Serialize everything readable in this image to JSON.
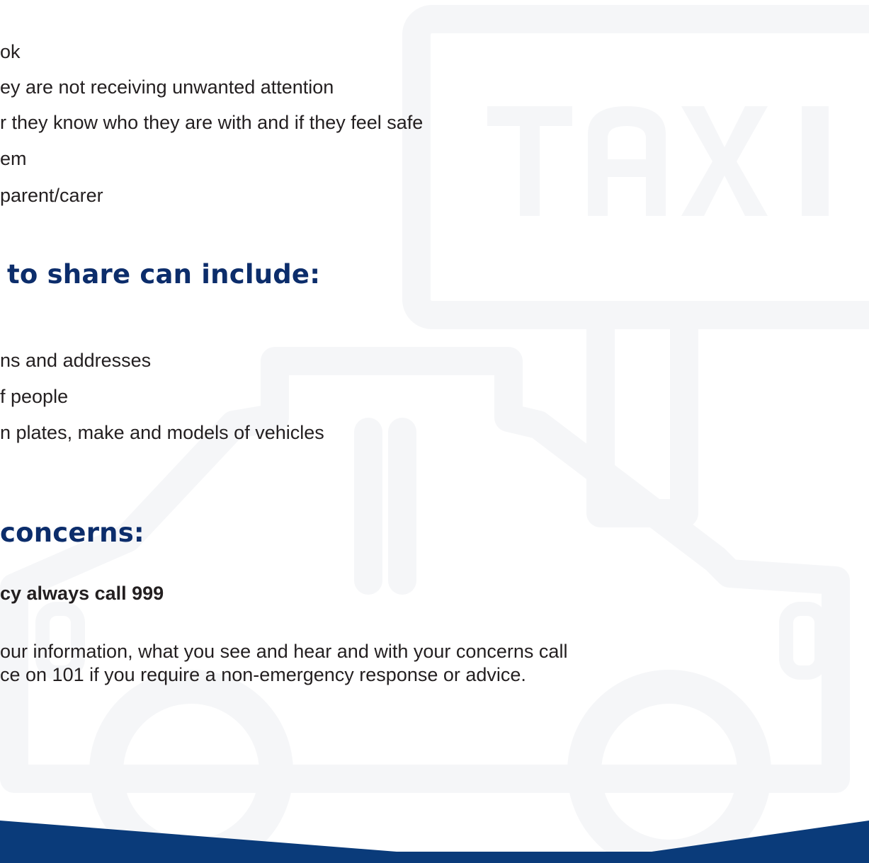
{
  "intro_list": {
    "items": [
      "ok",
      "ey are not receiving unwanted attention",
      "r they know who they are with and if they feel safe",
      "em",
      " parent/carer"
    ]
  },
  "share_section": {
    "heading": "to share can include:",
    "items": [
      "ns and addresses",
      "f people",
      "n plates, make and models of vehicles"
    ]
  },
  "concerns_section": {
    "heading": "concerns:",
    "emergency_line": "cy always call 999",
    "advice_lines": [
      "our information, what you see and hear and with your concerns call",
      "ce on 101 if you require a non-emergency response or advice."
    ]
  },
  "watermark": {
    "sign_text": "TAXI",
    "icon": "taxi-icon"
  },
  "colors": {
    "heading": "#0c2d6b",
    "footer": "#0a3b7a",
    "watermark": "#f5f6f8",
    "body_text": "#231f20"
  }
}
